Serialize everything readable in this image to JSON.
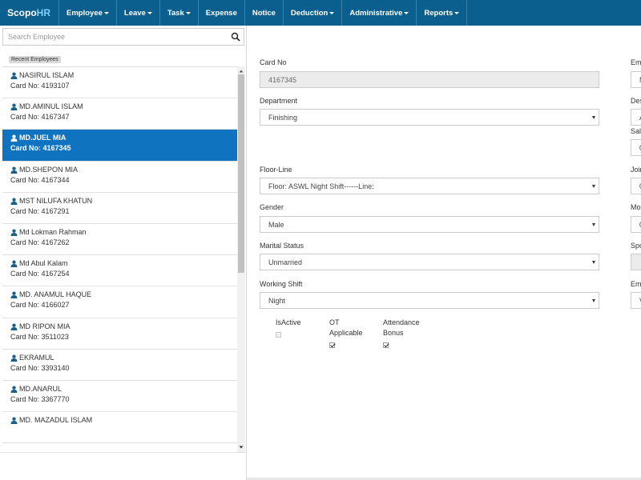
{
  "navbar": {
    "brand_main": "Scopo",
    "brand_hr": "HR",
    "items": [
      {
        "label": "Employee",
        "dropdown": true
      },
      {
        "label": "Leave",
        "dropdown": true
      },
      {
        "label": "Task",
        "dropdown": true
      },
      {
        "label": "Expense",
        "dropdown": false
      },
      {
        "label": "Notice",
        "dropdown": false
      },
      {
        "label": "Deduction",
        "dropdown": true
      },
      {
        "label": "Administrative",
        "dropdown": true
      },
      {
        "label": "Reports",
        "dropdown": true
      }
    ]
  },
  "sidebar": {
    "search_placeholder": "Search Employee",
    "recent_label": "Recent Employees",
    "employees": [
      {
        "name": "NASIRUL ISLAM",
        "card": "Card No: 4193107",
        "active": false
      },
      {
        "name": "MD.AMINUL ISLAM",
        "card": "Card No: 4167347",
        "active": false
      },
      {
        "name": "MD.JUEL MIA",
        "card": "Card No: 4167345",
        "active": true
      },
      {
        "name": "MD.SHEPON MIA",
        "card": "Card No: 4167344",
        "active": false
      },
      {
        "name": "MST NILUFA KHATUN",
        "card": "Card No: 4167291",
        "active": false
      },
      {
        "name": "Md Lokman Rahman",
        "card": "Card No: 4167262",
        "active": false
      },
      {
        "name": "Md Abul Kalam",
        "card": "Card No: 4167254",
        "active": false
      },
      {
        "name": "MD. ANAMUL HAQUE",
        "card": "Card No: 4166027",
        "active": false
      },
      {
        "name": "MD RIPON MIA",
        "card": "Card No: 3511023",
        "active": false
      },
      {
        "name": "EKRAMUL",
        "card": "Card No: 3393140",
        "active": false
      },
      {
        "name": "MD.ANARUL",
        "card": "Card No: 3367770",
        "active": false
      },
      {
        "name": "MD. MAZADUL ISLAM",
        "card": "",
        "active": false
      }
    ]
  },
  "form": {
    "card_no_label": "Card No",
    "card_no_value": "4167345",
    "department_label": "Department",
    "department_value": "Finishing",
    "floor_line_label": "Floor-Line",
    "floor_line_value": "Floor: ASWL Night Shift------Line:",
    "gender_label": "Gender",
    "gender_value": "Male",
    "marital_label": "Marital Status",
    "marital_value": "Unmarried",
    "shift_label": "Working Shift",
    "shift_value": "Night",
    "isactive_label": "IsActive",
    "ot_label_1": "OT",
    "ot_label_2": "Applicable",
    "bonus_label_1": "Attendance",
    "bonus_label_2": "Bonus",
    "right_col": {
      "labels": [
        "Em",
        "Des",
        "Sal",
        "Join",
        "Mo",
        "Spo",
        "Em"
      ],
      "values": [
        "M",
        "A",
        "0",
        "0",
        "0",
        "",
        "V"
      ]
    }
  },
  "colors": {
    "navbar": "#0b5f8e",
    "active_item": "#0f73c0",
    "person_icon": "#1a5f8a"
  }
}
